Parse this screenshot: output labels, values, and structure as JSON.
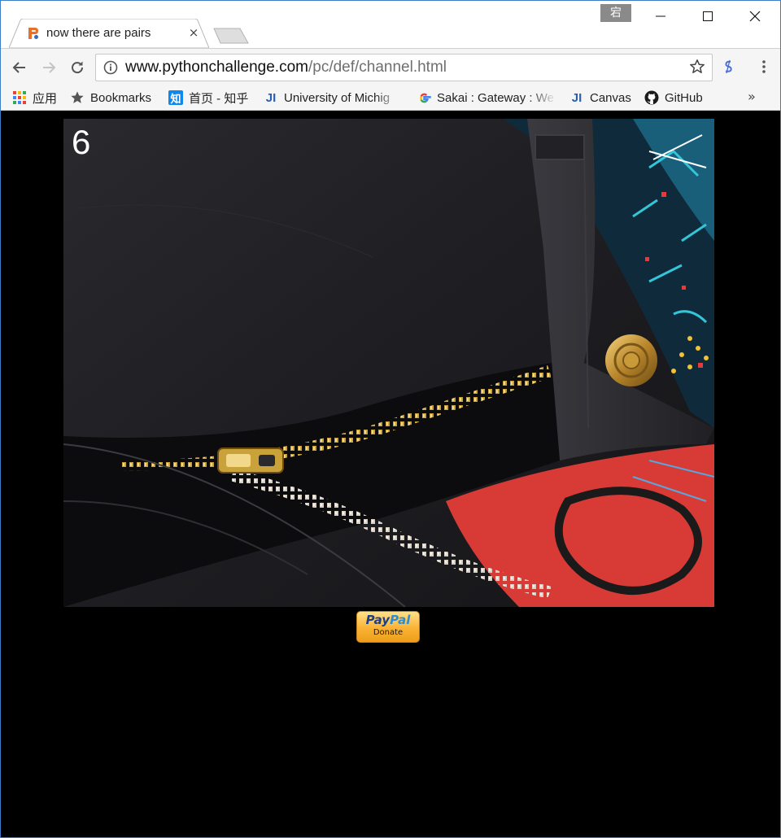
{
  "tab": {
    "title": "now there are pairs",
    "close_glyph": "×",
    "favicon": "pythonchallenge-favicon"
  },
  "ime_badge": "宕",
  "window_controls": [
    "minimize",
    "maximize",
    "close"
  ],
  "toolbar": {
    "url_host": "www.pythonchallenge.com",
    "url_path": "/pc/def/channel.html",
    "bookmark_star": "star-icon",
    "extension": "extension-icon",
    "menu": "menu-icon"
  },
  "bookmarks": {
    "items": [
      {
        "label": "应用",
        "icon": "apps-grid-icon"
      },
      {
        "label": "Bookmarks",
        "icon": "star-icon"
      },
      {
        "label": "首页 - 知乎",
        "icon": "zhihu-icon"
      },
      {
        "label": "University of Michig",
        "icon": "ji-icon"
      },
      {
        "label": "Sakai : Gateway : We",
        "icon": "google-icon"
      },
      {
        "label": "Canvas",
        "icon": "ji-icon"
      },
      {
        "label": "GitHub",
        "icon": "github-icon"
      }
    ],
    "overflow_glyph": "»"
  },
  "page": {
    "level_number": "6",
    "image_subject": "open zipper on black jeans",
    "donate": {
      "logo_pay": "Pay",
      "logo_pal": "Pal",
      "label": "Donate"
    }
  },
  "colors": {
    "page_background": "#000000",
    "window_border": "#3c7ec7",
    "paypal_orange": "#f9b233"
  }
}
